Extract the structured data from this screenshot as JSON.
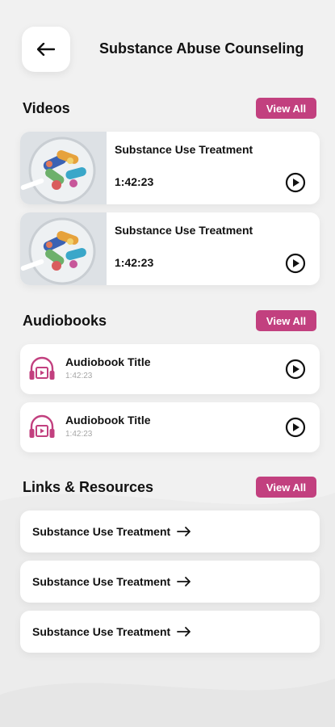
{
  "header": {
    "title": "Substance Abuse Counseling",
    "back_icon": "arrow-left-icon"
  },
  "colors": {
    "accent": "#c2407f",
    "background": "#f1f1f1",
    "card": "#ffffff"
  },
  "videos": {
    "title": "Videos",
    "view_all": "View All",
    "items": [
      {
        "title": "Substance Use Treatment",
        "duration": "1:42:23"
      },
      {
        "title": "Substance Use Treatment",
        "duration": "1:42:23"
      }
    ]
  },
  "audiobooks": {
    "title": "Audiobooks",
    "view_all": "View All",
    "items": [
      {
        "title": "Audiobook Title",
        "duration": "1:42:23"
      },
      {
        "title": "Audiobook Title",
        "duration": "1:42:23"
      }
    ]
  },
  "links": {
    "title": "Links & Resources",
    "view_all": "View All",
    "items": [
      {
        "label": "Substance Use Treatment"
      },
      {
        "label": "Substance Use Treatment"
      },
      {
        "label": "Substance Use Treatment"
      }
    ]
  }
}
